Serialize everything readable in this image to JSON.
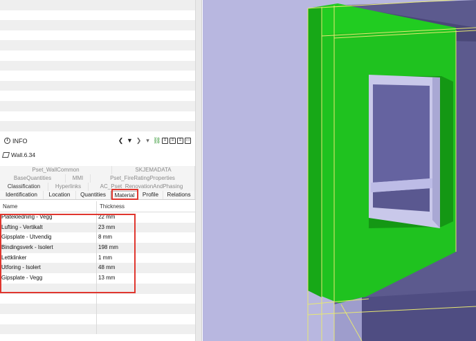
{
  "info_panel": {
    "title": "INFO",
    "entity_name": "Wall.6.34",
    "toolbar_icons": [
      "chevron-left-icon",
      "triangle-down-icon",
      "chevron-right-icon",
      "triangle-down-small-icon",
      "link-icon",
      "clipboard-icon",
      "clipboard-icon",
      "clipboard-icon",
      "window-icon"
    ]
  },
  "tabs": {
    "row1": [
      "Pset_WallCommon",
      "SKJEMADATA"
    ],
    "row2": [
      "BaseQuantities",
      "MMI",
      "Pset_FireRatingProperties"
    ],
    "row3": [
      "Classification",
      "Hyperlinks",
      "AC_Pset_RenovationAndPhasing"
    ],
    "main": [
      "Identification",
      "Location",
      "Quantities",
      "Material",
      "Profile",
      "Relations"
    ],
    "selected": "Material"
  },
  "material_table": {
    "headers": [
      "Name",
      "Thickness"
    ],
    "rows": [
      {
        "name": "Platekledning - Vegg",
        "thickness": "22 mm"
      },
      {
        "name": "Lufting - Vertikalt",
        "thickness": "23 mm"
      },
      {
        "name": "Gipsplate - Utvendig",
        "thickness": "8 mm"
      },
      {
        "name": "Bindingsverk - Isolert",
        "thickness": "198 mm"
      },
      {
        "name": "Lettklinker",
        "thickness": "1 mm"
      },
      {
        "name": "Utforing - Isolert",
        "thickness": "48 mm"
      },
      {
        "name": "Gipsplate - Vegg",
        "thickness": "13 mm"
      }
    ]
  },
  "colors": {
    "highlight": "#e0362e",
    "wall_green": "#1fc21f",
    "background_3d": "#b8b7e0",
    "window_frame": "#c9c8ea",
    "glass": "#5a5890"
  }
}
